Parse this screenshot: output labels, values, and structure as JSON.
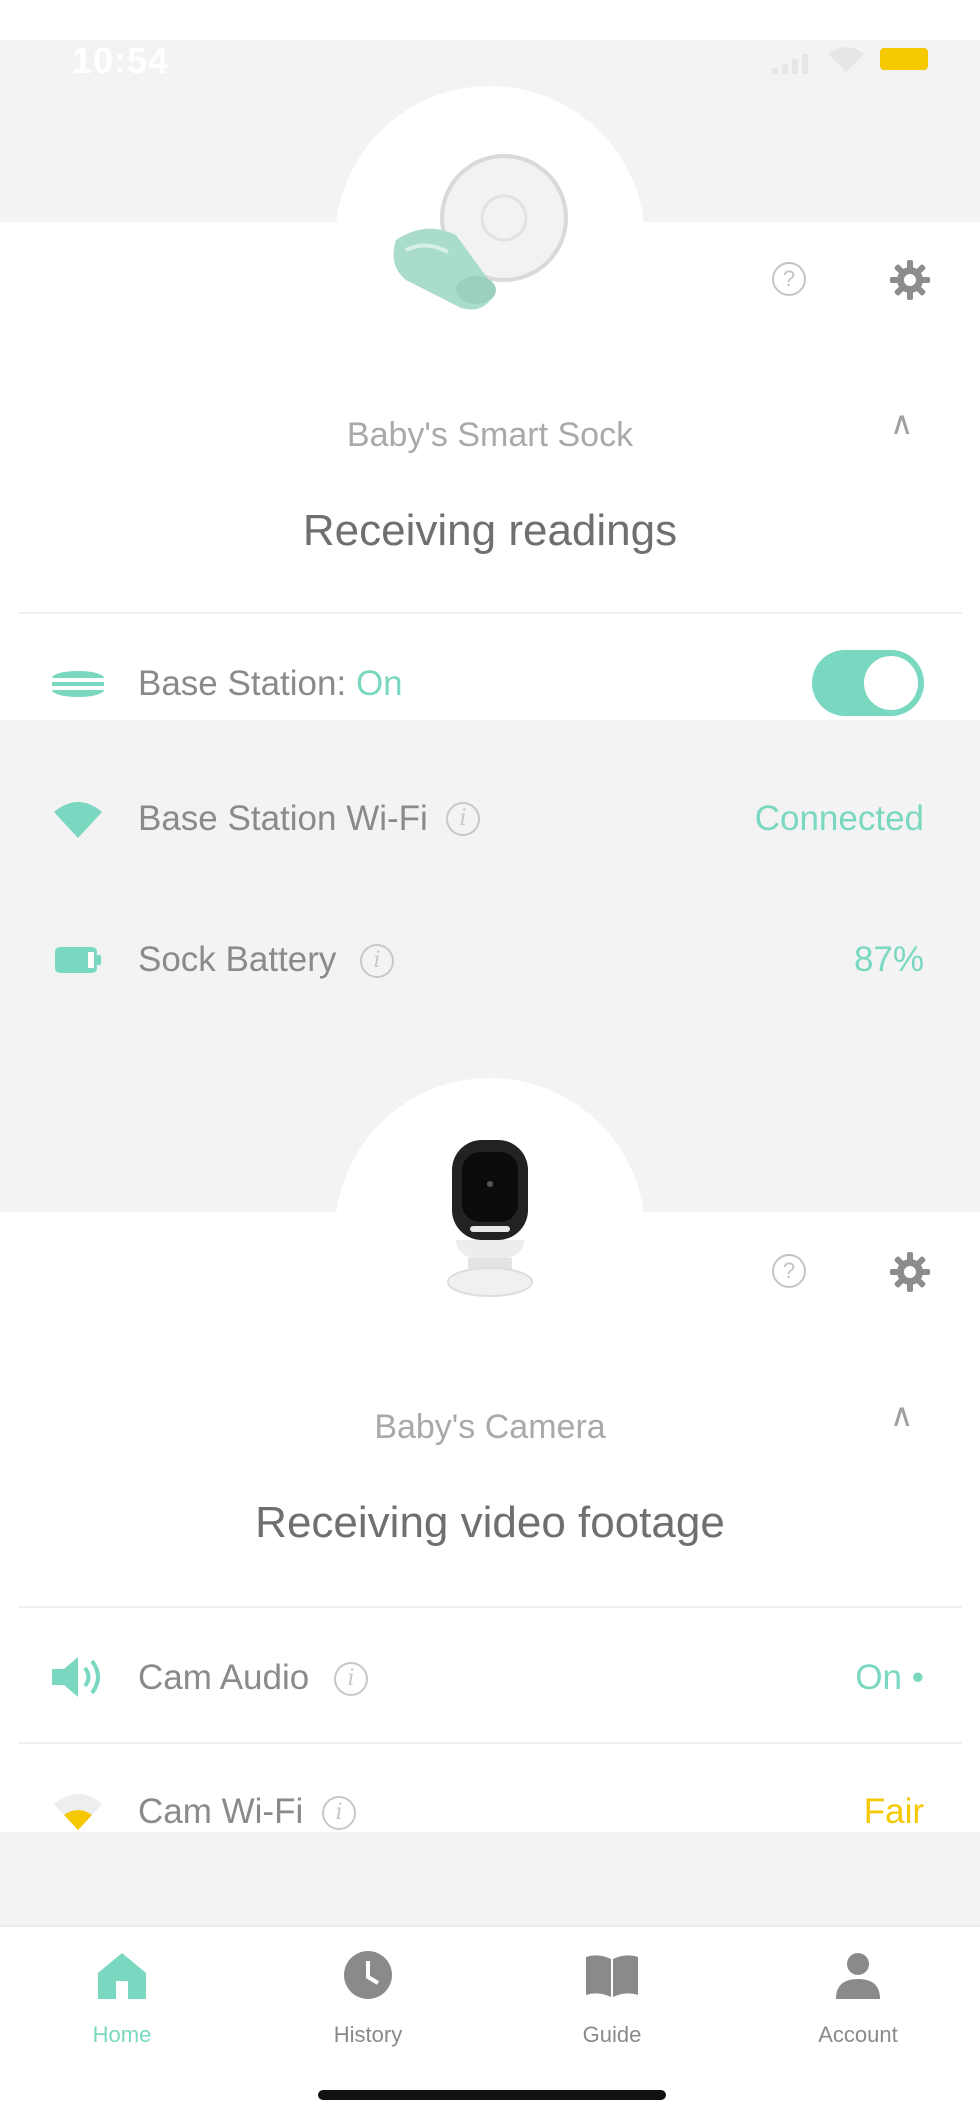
{
  "status_bar": {
    "time": "10:54"
  },
  "sock_card": {
    "label": "Baby's Smart Sock",
    "status": "Receiving readings",
    "rows": [
      {
        "label": "Base Station:",
        "value": "On",
        "icon": "base-station-icon"
      },
      {
        "label": "Base Station Wi-Fi",
        "value": "Connected",
        "icon": "wifi-icon"
      },
      {
        "label": "Sock Battery",
        "value": "87%",
        "icon": "battery-icon"
      }
    ]
  },
  "camera_card": {
    "label": "Baby's Camera",
    "status": "Receiving video footage",
    "rows": [
      {
        "label": "Cam Audio",
        "value": "On •",
        "icon": "speaker-icon"
      },
      {
        "label": "Cam Wi-Fi",
        "value": "Fair",
        "icon": "wifi-icon"
      }
    ]
  },
  "nav": {
    "items": [
      {
        "label": "Home",
        "active": true
      },
      {
        "label": "History",
        "active": false
      },
      {
        "label": "Guide",
        "active": false
      },
      {
        "label": "Account",
        "active": false
      }
    ]
  },
  "colors": {
    "accent": "#7ad8c0",
    "fair": "#f6c800",
    "grey_band": "#f3f3f3",
    "text": "#8a8a8a"
  }
}
